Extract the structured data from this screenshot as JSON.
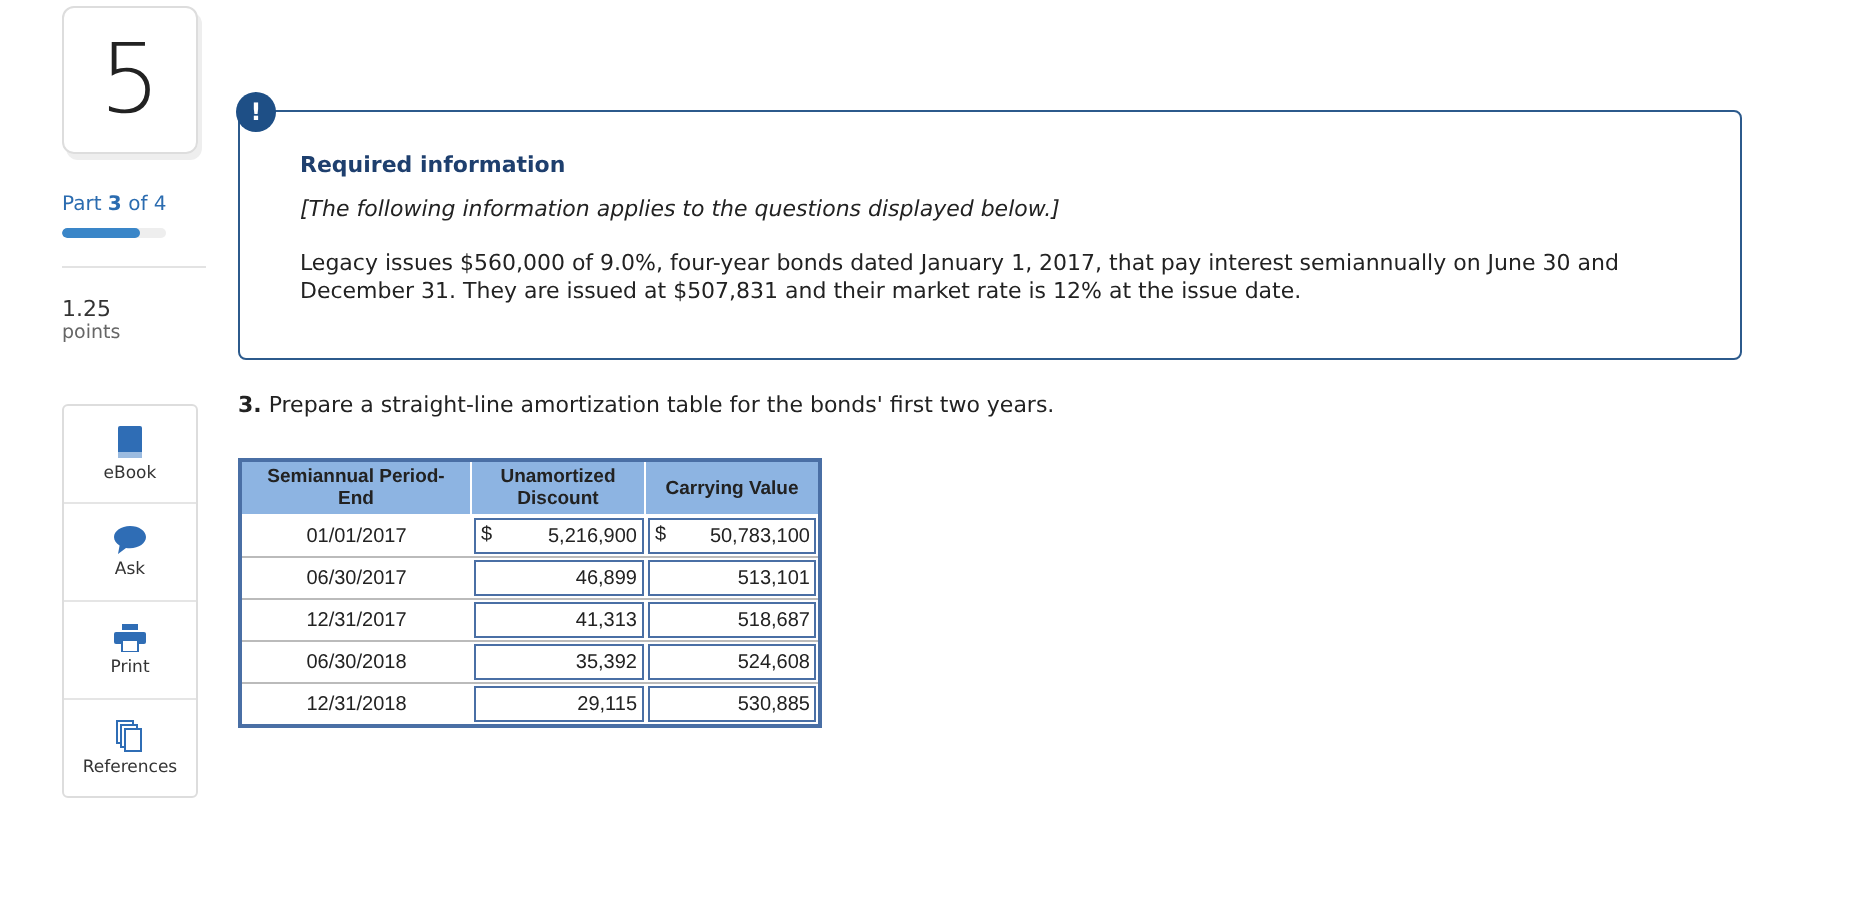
{
  "question_number": "5",
  "part": {
    "text": "Part **3** of 4",
    "level": 0.75
  },
  "points": {
    "value": "1.25",
    "label": "points"
  },
  "tools": [
    {
      "kind": "book",
      "label": "eBook"
    },
    {
      "kind": "chat",
      "label": "Ask"
    },
    {
      "kind": "print",
      "label": "Print"
    },
    {
      "kind": "pages",
      "label": "References"
    }
  ],
  "info_box": {
    "badge": "!",
    "title": "Required information",
    "note": "[The following information applies to the questions displayed below.]",
    "body": "Legacy issues $560,000 of 9.0%, four-year bonds dated January 1, 2017, that pay interest semiannually on June 30 and December 31. They are issued at $507,831 and their market rate is 12% at the issue date."
  },
  "question": "**3.** Prepare a straight-line amortization table for the bonds' first two years.",
  "table": {
    "columns": [
      "Semiannual Period-End",
      "Unamortized Discount",
      "Carrying Value"
    ],
    "rows": [
      {
        "period": "01/01/2017",
        "discount": {
          "prefix": "$",
          "value": "5,216,900"
        },
        "carrying": {
          "prefix": "$",
          "value": "50,783,100"
        }
      },
      {
        "period": "06/30/2017",
        "discount": {
          "value": "46,899"
        },
        "carrying": {
          "value": "513,101"
        }
      },
      {
        "period": "12/31/2017",
        "discount": {
          "value": "41,313"
        },
        "carrying": {
          "value": "518,687"
        }
      },
      {
        "period": "06/30/2018",
        "discount": {
          "value": "35,392"
        },
        "carrying": {
          "value": "524,608"
        }
      },
      {
        "period": "12/31/2018",
        "discount": {
          "value": "29,115"
        },
        "carrying": {
          "value": "530,885"
        }
      }
    ]
  }
}
